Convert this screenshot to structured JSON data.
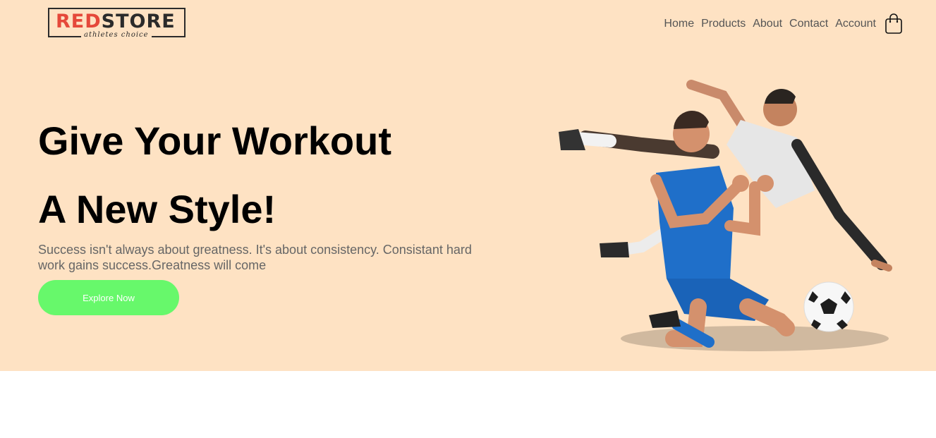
{
  "brand": {
    "logo_red": "RED",
    "logo_dark": "STORE",
    "tagline": "athletes choice"
  },
  "nav": {
    "items": [
      {
        "label": "Home"
      },
      {
        "label": "Products"
      },
      {
        "label": "About"
      },
      {
        "label": "Contact"
      },
      {
        "label": "Account"
      }
    ],
    "cart_icon": "shopping-bag-icon"
  },
  "hero": {
    "title_line1": "Give Your Workout",
    "title_line2": "A New Style!",
    "subtitle": "Success isn't always about greatness. It's about consistency. Consistant hard work gains success.Greatness will come",
    "cta_label": "Explore Now",
    "image": "football-players-illustration"
  },
  "colors": {
    "hero_bg": "#fee2c3",
    "cta": "#67f86b",
    "brand_red": "#e5483a"
  }
}
